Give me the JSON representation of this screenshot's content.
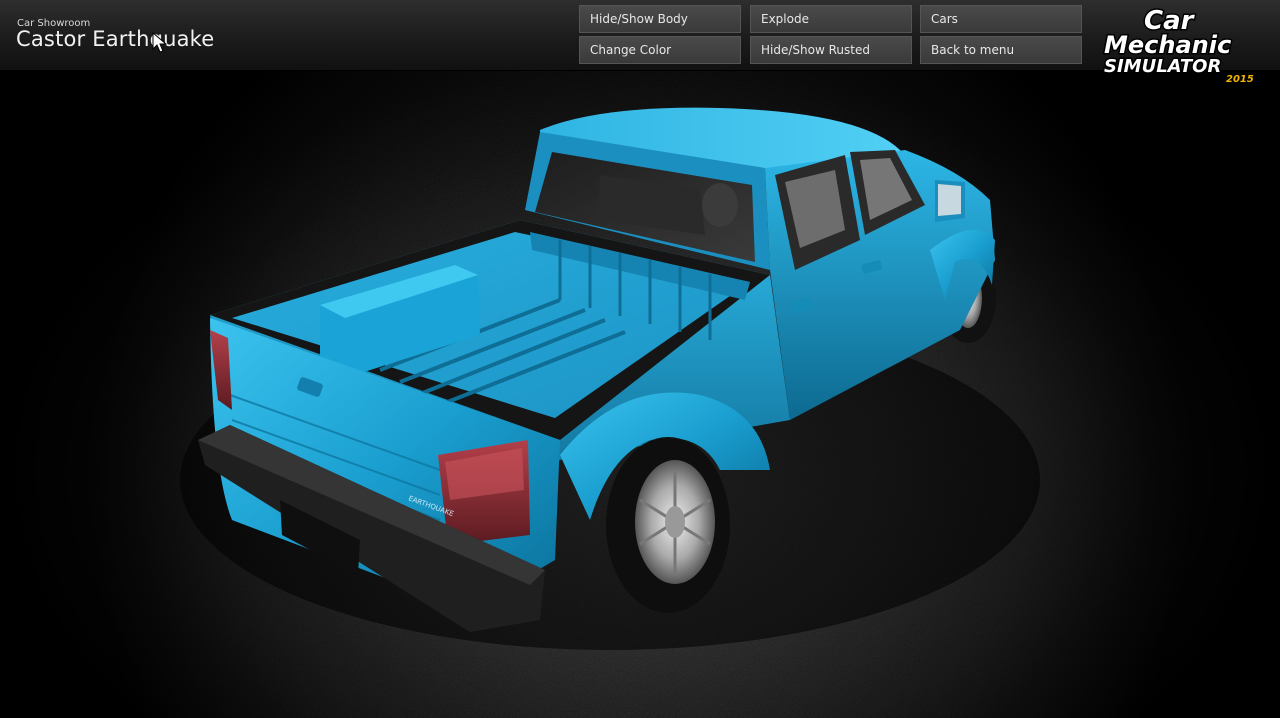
{
  "header": {
    "subtitle": "Car Showroom",
    "title": "Castor Earthquake"
  },
  "menu": {
    "hide_show_body": "Hide/Show Body",
    "explode": "Explode",
    "cars": "Cars",
    "change_color": "Change Color",
    "hide_show_rusted": "Hide/Show Rusted",
    "back_to_menu": "Back to menu"
  },
  "logo": {
    "line1": "Car",
    "line2": "Mechanic",
    "line3": "SIMULATOR",
    "year": "2015"
  },
  "truck": {
    "badge": "EARTHQUAKE"
  },
  "colors": {
    "car_body": "#1fa7d6",
    "logo_year": "#f0b400",
    "button_bg": "#424242"
  }
}
